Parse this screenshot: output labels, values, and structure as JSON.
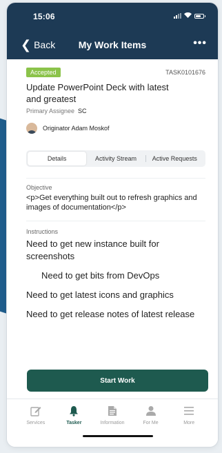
{
  "status_bar": {
    "time": "15:06"
  },
  "nav": {
    "back_label": "Back",
    "title": "My Work Items",
    "more": "•••"
  },
  "task": {
    "state": "Accepted",
    "number": "TASK0101676",
    "title": "Update PowerPoint Deck with latest and greatest",
    "assignee_label": "Primary Assignee",
    "assignee_value": "SC",
    "originator": "Originator Adam Moskof"
  },
  "tabs": [
    {
      "label": "Details",
      "active": true
    },
    {
      "label": "Activity Stream",
      "active": false
    },
    {
      "label": "Active Requests",
      "active": false
    }
  ],
  "objective": {
    "label": "Objective",
    "text": "<p>Get everything built out to refresh graphics and images of documentation</p>"
  },
  "instructions": {
    "label": "Instructions",
    "lines": [
      "Need to get new instance built for screenshots",
      "Need to get bits from DevOps",
      "Need to get latest icons and graphics",
      "Need to get release notes of latest release"
    ]
  },
  "action": {
    "start_label": "Start Work"
  },
  "tabbar": [
    {
      "label": "Services",
      "icon": "pencil-icon"
    },
    {
      "label": "Tasker",
      "icon": "bell-icon",
      "active": true
    },
    {
      "label": "Information",
      "icon": "document-icon"
    },
    {
      "label": "For Me",
      "icon": "person-icon"
    },
    {
      "label": "More",
      "icon": "menu-icon"
    }
  ],
  "colors": {
    "header": "#1d3a55",
    "accent": "#1e5a4f",
    "badge": "#8bc34a"
  }
}
